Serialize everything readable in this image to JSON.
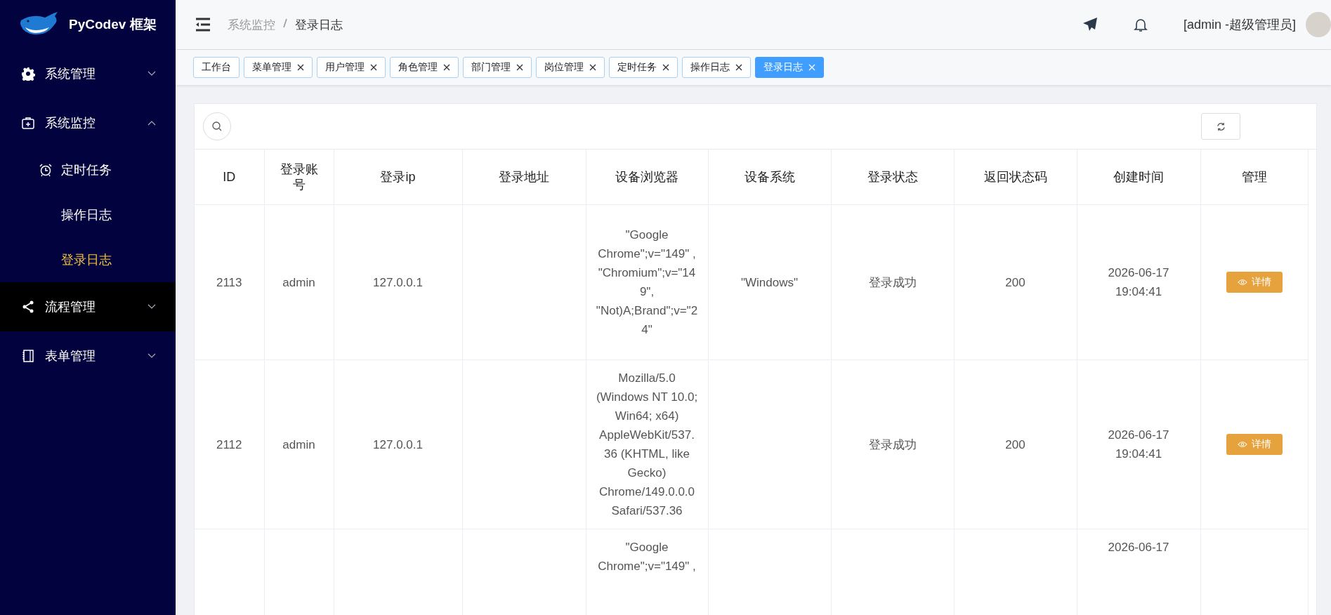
{
  "sidebar": {
    "logo_text": "PyCodev 框架",
    "items": [
      {
        "label": "系统管理",
        "expanded": false,
        "hovered": false
      },
      {
        "label": "系统监控",
        "expanded": true,
        "hovered": false,
        "children": [
          {
            "label": "定时任务",
            "selected": false
          },
          {
            "label": "操作日志",
            "selected": false
          },
          {
            "label": "登录日志",
            "selected": true
          }
        ]
      },
      {
        "label": "流程管理",
        "expanded": false,
        "hovered": true
      },
      {
        "label": "表单管理",
        "expanded": false,
        "hovered": false
      }
    ]
  },
  "header": {
    "breadcrumb": [
      "系统监控",
      "登录日志"
    ],
    "user": "[admin -超级管理员]"
  },
  "tags": [
    {
      "label": "工作台",
      "closable": false,
      "selected": false
    },
    {
      "label": "菜单管理",
      "closable": true,
      "selected": false
    },
    {
      "label": "用户管理",
      "closable": true,
      "selected": false
    },
    {
      "label": "角色管理",
      "closable": true,
      "selected": false
    },
    {
      "label": "部门管理",
      "closable": true,
      "selected": false
    },
    {
      "label": "岗位管理",
      "closable": true,
      "selected": false
    },
    {
      "label": "定时任务",
      "closable": true,
      "selected": false
    },
    {
      "label": "操作日志",
      "closable": true,
      "selected": false
    },
    {
      "label": "登录日志",
      "closable": true,
      "selected": true
    }
  ],
  "table": {
    "columns": [
      "ID",
      "登录账号",
      "登录ip",
      "登录地址",
      "设备浏览器",
      "设备系统",
      "登录状态",
      "返回状态码",
      "创建时间",
      "管理"
    ],
    "rows": [
      {
        "id": "2113",
        "account": "admin",
        "ip": "127.0.0.1",
        "address": "",
        "browser": "\"Google Chrome\";v=\"149\" , \"Chromium\";v=\"149\", \"Not)A;Brand\";v=\"24\"",
        "os": "\"Windows\"",
        "status": "登录成功",
        "code": "200",
        "created": "2026-06-17 19:04:41",
        "action": "详情"
      },
      {
        "id": "2112",
        "account": "admin",
        "ip": "127.0.0.1",
        "address": "",
        "browser": "Mozilla/5.0 (Windows NT 10.0; Win64; x64) AppleWebKit/537.36 (KHTML, like Gecko) Chrome/149.0.0.0 Safari/537.36",
        "os": "",
        "status": "登录成功",
        "code": "200",
        "created": "2026-06-17 19:04:41",
        "action": "详情"
      },
      {
        "id": "",
        "account": "",
        "ip": "",
        "address": "",
        "browser": "\"Google Chrome\";v=\"149\" ,",
        "os": "",
        "status": "",
        "code": "",
        "created": "2026-06-17",
        "action": ""
      }
    ]
  }
}
